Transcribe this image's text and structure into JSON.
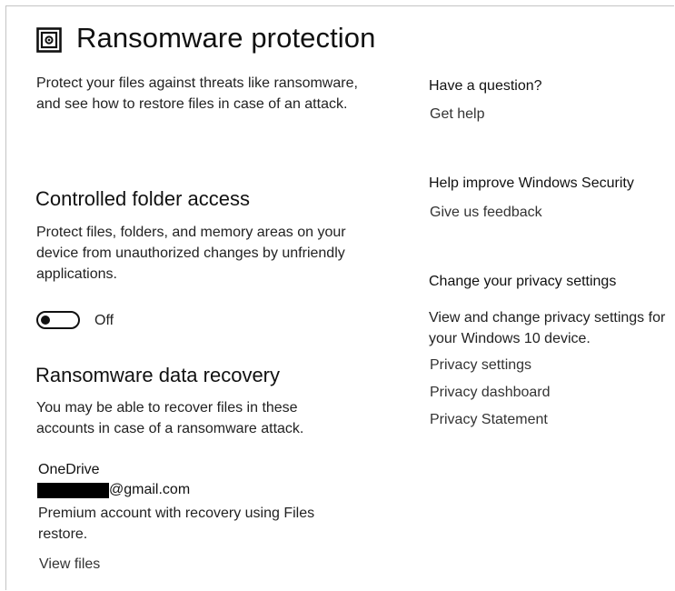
{
  "header": {
    "title": "Ransomware protection",
    "icon": "ransomware-shield-icon",
    "description": "Protect your files against threats like ransomware, and see how to restore files in case of an attack."
  },
  "controlled_folder_access": {
    "heading": "Controlled folder access",
    "description": "Protect files, folders, and memory areas on your device from unauthorized changes by unfriendly applications.",
    "toggle_state": "Off",
    "toggle_on": false
  },
  "data_recovery": {
    "heading": "Ransomware data recovery",
    "description": "You may be able to recover files in these accounts in case of a ransomware attack.",
    "provider": "OneDrive",
    "account_email_suffix": "@gmail.com",
    "account_details": "Premium account with recovery using Files restore.",
    "view_files_label": "View files"
  },
  "sidebar": {
    "question": {
      "heading": "Have a question?",
      "link": "Get help"
    },
    "improve": {
      "heading": "Help improve Windows Security",
      "link": "Give us feedback"
    },
    "privacy": {
      "heading": "Change your privacy settings",
      "description": "View and change privacy settings for your Windows 10 device.",
      "links": [
        "Privacy settings",
        "Privacy dashboard",
        "Privacy Statement"
      ]
    }
  },
  "colors": {
    "text": "#1a1a1a",
    "link": "#333333",
    "border": "#c4c4c4"
  }
}
